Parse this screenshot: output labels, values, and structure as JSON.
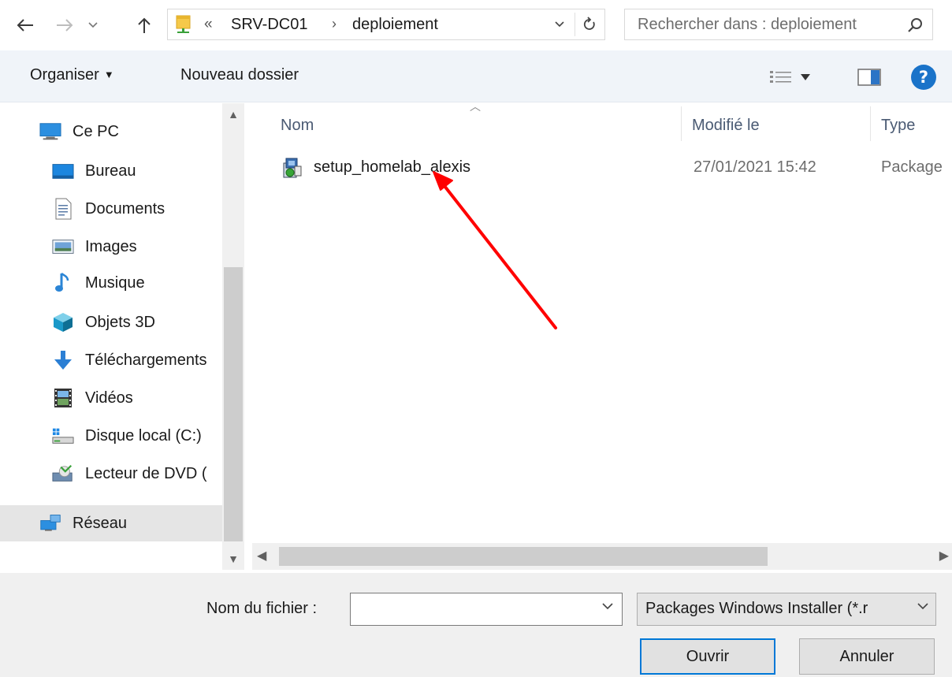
{
  "address_bar": {
    "back_icon": "arrow-left-icon",
    "forward_icon": "arrow-right-icon",
    "recent_icon": "chevron-down-icon",
    "up_icon": "arrow-up-icon",
    "overflow": "«",
    "breadcrumb": [
      "SRV-DC01",
      "deploiement"
    ],
    "separator": "›",
    "refresh_icon": "refresh-icon"
  },
  "search": {
    "placeholder": "Rechercher dans : deploiement",
    "icon": "search-icon"
  },
  "toolbar": {
    "organise_label": "Organiser",
    "new_folder_label": "Nouveau dossier",
    "help_label": "?"
  },
  "nav_pane": {
    "items": [
      {
        "label": "Ce PC",
        "icon": "computer-icon"
      },
      {
        "label": "Bureau",
        "icon": "desktop-icon"
      },
      {
        "label": "Documents",
        "icon": "documents-icon"
      },
      {
        "label": "Images",
        "icon": "images-icon"
      },
      {
        "label": "Musique",
        "icon": "music-icon"
      },
      {
        "label": "Objets 3D",
        "icon": "cube-3d-icon"
      },
      {
        "label": "Téléchargements",
        "icon": "download-icon"
      },
      {
        "label": "Vidéos",
        "icon": "video-icon"
      },
      {
        "label": "Disque local (C:)",
        "icon": "drive-icon"
      },
      {
        "label": "Lecteur de DVD (",
        "icon": "dvd-drive-icon"
      },
      {
        "label": "Réseau",
        "icon": "network-icon"
      }
    ],
    "selected": "Réseau"
  },
  "file_list": {
    "columns": [
      "Nom",
      "Modifié le",
      "Type"
    ],
    "rows": [
      {
        "name": "setup_homelab_alexis",
        "modified": "27/01/2021 15:42",
        "type": "Package",
        "icon": "msi-installer-icon"
      }
    ]
  },
  "annotation": {
    "color": "#ff0000"
  },
  "bottom": {
    "filename_label": "Nom du fichier :",
    "filename_value": "",
    "filetype_value": "Packages Windows Installer (*.r",
    "open_label": "Ouvrir",
    "cancel_label": "Annuler"
  },
  "colors": {
    "toolbar_bg": "#f0f4f9",
    "accent": "#0078d7",
    "help": "#1a73c9"
  }
}
